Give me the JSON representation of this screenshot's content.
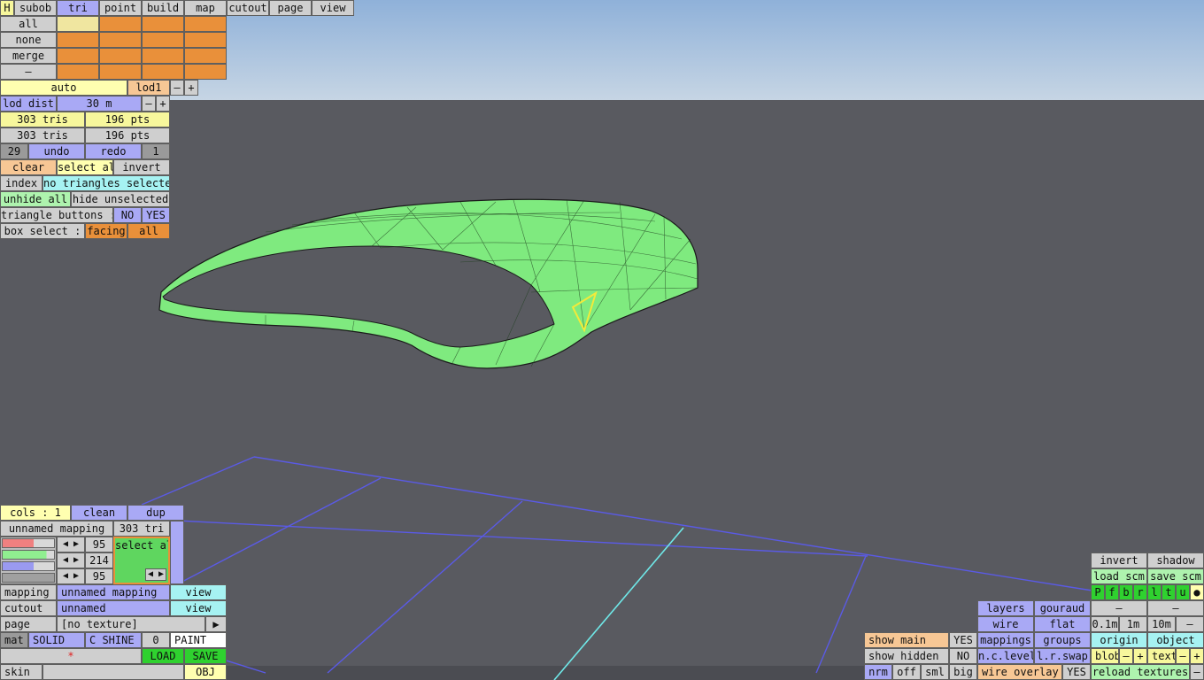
{
  "menu": {
    "h": "H",
    "subob": "subob",
    "tri": "tri",
    "point": "point",
    "build": "build",
    "map": "map",
    "cutout": "cutout",
    "page": "page",
    "view": "view"
  },
  "select_list": {
    "all": "all",
    "none": "none",
    "merge": "merge",
    "dash": "–"
  },
  "lod": {
    "auto": "auto",
    "lod1": "lod1",
    "minus": "–",
    "plus": "+",
    "dist_label": "lod dist",
    "dist_value": "30 m"
  },
  "counts": {
    "tris_a": "303 tris",
    "pts_a": "196 pts",
    "tris_b": "303 tris",
    "pts_b": "196 pts"
  },
  "history": {
    "undo_count": "29",
    "undo": "undo",
    "redo": "redo",
    "redo_count": "1"
  },
  "selection": {
    "clear": "clear",
    "select_all": "select all",
    "invert": "invert",
    "index": "index",
    "status": "no triangles selected",
    "unhide_all": "unhide all",
    "hide_unselected": "hide unselected"
  },
  "triangle_buttons": {
    "label": "triangle buttons :",
    "no": "NO",
    "yes": "YES"
  },
  "box_select": {
    "label": "box select :",
    "facing": "facing",
    "all": "all"
  },
  "colors": {
    "cols": "cols : 1",
    "clean": "clean",
    "dup": "dup",
    "mapping_name": "unnamed mapping",
    "tri_count": "303 tri",
    "r": "95",
    "g": "214",
    "b": "95",
    "select_all": "select all",
    "swatch": "#5fd65f"
  },
  "mapping_panel": {
    "mapping_label": "mapping",
    "mapping_value": "unnamed mapping",
    "mapping_view": "view",
    "cutout_label": "cutout",
    "cutout_value": "unnamed",
    "cutout_view": "view",
    "page_label": "page",
    "page_value": "[no texture]",
    "page_arrow": "▶",
    "mat": "mat",
    "solid": "SOLID",
    "c_shine": "C SHINE",
    "zero": "0",
    "paint": "PAINT",
    "star": "*",
    "load": "LOAD",
    "save": "SAVE",
    "skin": "skin",
    "obj": "OBJ"
  },
  "view_panel": {
    "invert": "invert",
    "shadow": "shadow",
    "load_scm": "load scm",
    "save_scm": "save scm",
    "flags": [
      "P",
      "f",
      "b",
      "r",
      "l",
      "t",
      "u",
      "●"
    ],
    "layers": "layers",
    "gouraud": "gouraud",
    "dash1": "–",
    "dash2": "–",
    "wire": "wire",
    "flat": "flat",
    "s01": "0.1m",
    "s1": "1m",
    "s10": "10m",
    "sminus": "–",
    "show_main": "show main",
    "show_main_val": "YES",
    "mappings": "mappings",
    "groups": "groups",
    "origin": "origin",
    "object": "object",
    "show_hidden": "show hidden",
    "show_hidden_val": "NO",
    "nc_level": "n.c.level",
    "lr_swap": "l.r.swap",
    "blob": "blob",
    "blob_minus": "–",
    "blob_plus": "+",
    "text": "text",
    "text_minus": "–",
    "text_plus": "+",
    "nrm": "nrm",
    "off": "off",
    "sml": "sml",
    "big": "big",
    "wire_overlay": "wire overlay",
    "wire_overlay_val": "YES",
    "reload_textures": "reload textures",
    "rt_minus": "–"
  },
  "palette": {
    "mesh": "#7fea7f",
    "selected_edge": "#f2ea3a",
    "grid": "#5a5ae6",
    "axis": "#6fe8e8"
  }
}
